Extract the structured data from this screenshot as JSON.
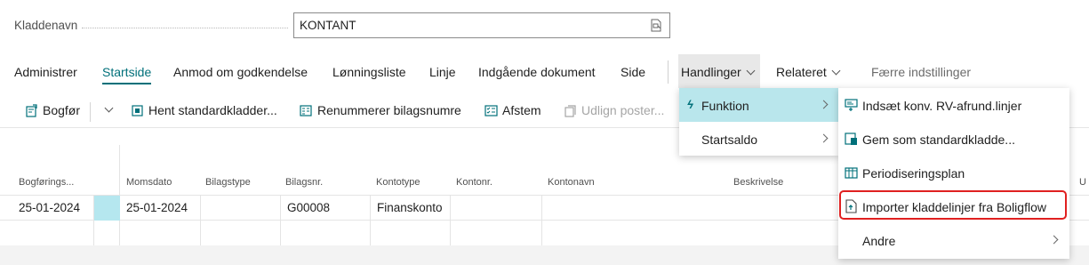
{
  "field": {
    "label": "Kladdenavn",
    "value": "KONTANT",
    "icon": "lookup-icon"
  },
  "nav": {
    "items": [
      "Administrer",
      "Startside",
      "Anmod om godkendelse",
      "Lønningsliste",
      "Linje",
      "Indgående dokument",
      "Side"
    ],
    "active": "Startside",
    "handlinger": "Handlinger",
    "relateret": "Relateret",
    "faerre": "Færre indstillinger"
  },
  "toolbar": {
    "bogfor": "Bogfør",
    "hent": "Hent standardkladder...",
    "renummerer": "Renummerer bilagsnumre",
    "afstem": "Afstem",
    "udlign": "Udlign poster..."
  },
  "grid": {
    "columns": [
      "Bogførings...",
      "Momsdato",
      "Bilagstype",
      "Bilagsnr.",
      "Kontotype",
      "Kontonr.",
      "Kontonavn",
      "Beskrivelse"
    ],
    "partial_column": "U",
    "row": {
      "bogforingsdato": "25-01-2024",
      "momsdato": "25-01-2024",
      "bilagsnr": "G00008",
      "kontotype": "Finanskonto"
    }
  },
  "menu_handlinger": {
    "items": [
      "Funktion",
      "Startsaldo"
    ],
    "selected": "Funktion"
  },
  "menu_funktion": {
    "items": [
      "Indsæt konv. RV-afrund.linjer",
      "Gem som standardkladde...",
      "Periodiseringsplan",
      "Importer kladdelinjer fra Boligflow",
      "Andre"
    ],
    "highlighted": "Importer kladdelinjer fra Boligflow"
  },
  "colors": {
    "accent": "#00707a",
    "selection": "#b9e6ec",
    "highlight_border": "#e02020"
  }
}
